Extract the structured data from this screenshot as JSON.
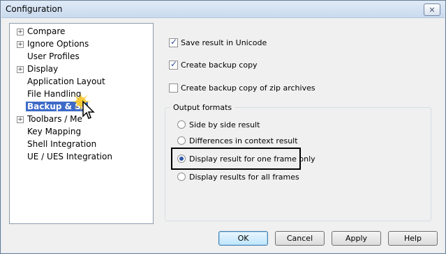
{
  "window": {
    "title": "Configuration"
  },
  "tree": {
    "items": [
      {
        "label": "Compare",
        "expandable": true
      },
      {
        "label": "Ignore Options",
        "expandable": true
      },
      {
        "label": "User Profiles",
        "expandable": false
      },
      {
        "label": "Display",
        "expandable": true
      },
      {
        "label": "Application Layout",
        "expandable": false
      },
      {
        "label": "File Handling",
        "expandable": false
      },
      {
        "label": "Backup & Sa",
        "expandable": false,
        "selected": true
      },
      {
        "label": "Toolbars / Me",
        "expandable": true
      },
      {
        "label": "Key Mapping",
        "expandable": false
      },
      {
        "label": "Shell Integration",
        "expandable": false
      },
      {
        "label": "UE / UES Integration",
        "expandable": false
      }
    ]
  },
  "options": {
    "save_unicode": {
      "label": "Save result in Unicode",
      "checked": true
    },
    "backup_copy": {
      "label": "Create backup copy",
      "checked": true
    },
    "backup_zip": {
      "label": "Create backup copy of zip archives",
      "checked": false
    }
  },
  "output_formats": {
    "title": "Output formats",
    "radios": [
      {
        "label": "Side by side result",
        "selected": false
      },
      {
        "label": "Differences in context result",
        "selected": false
      },
      {
        "label": "Display result for one frame only",
        "selected": true
      },
      {
        "label": "Display results for all frames",
        "selected": false
      }
    ]
  },
  "buttons": {
    "ok": "OK",
    "cancel": "Cancel",
    "apply": "Apply",
    "help": "Help"
  }
}
